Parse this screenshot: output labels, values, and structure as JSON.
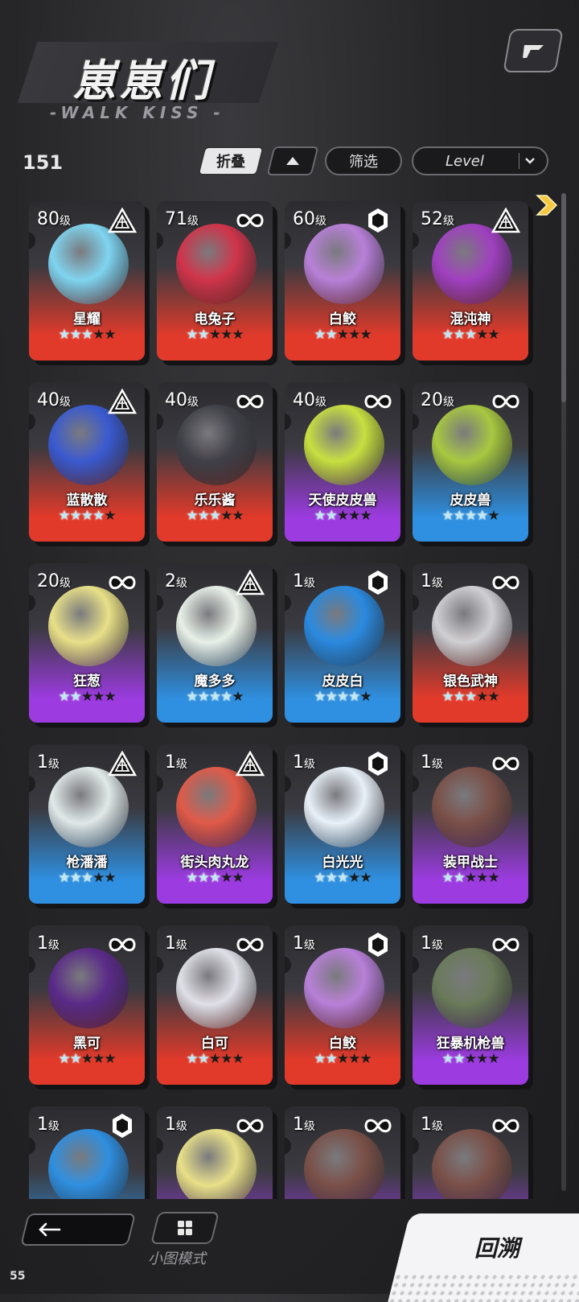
{
  "header": {
    "title": "崽崽们",
    "subtitle": "-WALK KISS -"
  },
  "toolbar": {
    "count": "151",
    "fold_label": "折叠",
    "filter_label": "筛选",
    "sort_label": "Level"
  },
  "colors": {
    "red": "#e23a2a",
    "purple": "#9b3be0",
    "blue": "#2f8fe0"
  },
  "cards": [
    {
      "level": "80",
      "unit": "级",
      "name": "星耀",
      "type": "triangle",
      "rarity": "red",
      "stars": 3,
      "art": "#7fd4f0"
    },
    {
      "level": "71",
      "unit": "级",
      "name": "电兔子",
      "type": "infinity",
      "rarity": "red",
      "stars": 2,
      "art": "#d0344a"
    },
    {
      "level": "60",
      "unit": "级",
      "name": "白鲛",
      "type": "hex",
      "rarity": "red",
      "stars": 2,
      "art": "#b880d8"
    },
    {
      "level": "52",
      "unit": "级",
      "name": "混沌神",
      "type": "triangle",
      "rarity": "red",
      "stars": 3,
      "art": "#a040c0"
    },
    {
      "level": "40",
      "unit": "级",
      "name": "蓝散散",
      "type": "triangle",
      "rarity": "red",
      "stars": 4,
      "art": "#3a5ad0"
    },
    {
      "level": "40",
      "unit": "级",
      "name": "乐乐酱",
      "type": "infinity",
      "rarity": "red",
      "stars": 3,
      "art": "#404048"
    },
    {
      "level": "40",
      "unit": "级",
      "name": "天使皮皮兽",
      "type": "infinity",
      "rarity": "purple",
      "stars": 2,
      "art": "#c8e040"
    },
    {
      "level": "20",
      "unit": "级",
      "name": "皮皮兽",
      "type": "infinity",
      "rarity": "blue",
      "stars": 4,
      "art": "#a8c840"
    },
    {
      "level": "20",
      "unit": "级",
      "name": "狂葱",
      "type": "infinity",
      "rarity": "purple",
      "stars": 2,
      "art": "#e8e088"
    },
    {
      "level": "2",
      "unit": "级",
      "name": "魔多多",
      "type": "triangle",
      "rarity": "blue",
      "stars": 4,
      "art": "#e8f0e8"
    },
    {
      "level": "1",
      "unit": "级",
      "name": "皮皮白",
      "type": "hex",
      "rarity": "blue",
      "stars": 4,
      "art": "#2a8ae0"
    },
    {
      "level": "1",
      "unit": "级",
      "name": "银色武神",
      "type": "infinity",
      "rarity": "red",
      "stars": 3,
      "art": "#d0d0d4"
    },
    {
      "level": "1",
      "unit": "级",
      "name": "枪潘潘",
      "type": "triangle",
      "rarity": "blue",
      "stars": 3,
      "art": "#e0e8e8"
    },
    {
      "level": "1",
      "unit": "级",
      "name": "街头肉丸龙",
      "type": "triangle",
      "rarity": "purple",
      "stars": 3,
      "art": "#e05a48"
    },
    {
      "level": "1",
      "unit": "级",
      "name": "白光光",
      "type": "hex",
      "rarity": "blue",
      "stars": 3,
      "art": "#e8f0f8"
    },
    {
      "level": "1",
      "unit": "级",
      "name": "装甲战士",
      "type": "infinity",
      "rarity": "purple",
      "stars": 2,
      "art": "#7a5048"
    },
    {
      "level": "1",
      "unit": "级",
      "name": "黑可",
      "type": "infinity",
      "rarity": "red",
      "stars": 2,
      "art": "#5a2a88"
    },
    {
      "level": "1",
      "unit": "级",
      "name": "白可",
      "type": "infinity",
      "rarity": "red",
      "stars": 2,
      "art": "#e0e0e8"
    },
    {
      "level": "1",
      "unit": "级",
      "name": "白鲛",
      "type": "hex",
      "rarity": "red",
      "stars": 2,
      "art": "#b880d8"
    },
    {
      "level": "1",
      "unit": "级",
      "name": "狂暴机枪兽",
      "type": "infinity",
      "rarity": "purple",
      "stars": 2,
      "art": "#6a7a5a"
    },
    {
      "level": "1",
      "unit": "级",
      "name": "",
      "type": "hex",
      "rarity": "blue",
      "stars": 0,
      "art": "#2f8fe0"
    },
    {
      "level": "1",
      "unit": "级",
      "name": "",
      "type": "infinity",
      "rarity": "purple",
      "stars": 0,
      "art": "#e8e088"
    },
    {
      "level": "1",
      "unit": "级",
      "name": "",
      "type": "infinity",
      "rarity": "purple",
      "stars": 0,
      "art": "#7a5048"
    },
    {
      "level": "1",
      "unit": "级",
      "name": "",
      "type": "infinity",
      "rarity": "purple",
      "stars": 0,
      "art": "#7a5048"
    }
  ],
  "bottom": {
    "mini_mode_label": "小图模式",
    "rewind_label": "回溯",
    "fps": "55"
  }
}
